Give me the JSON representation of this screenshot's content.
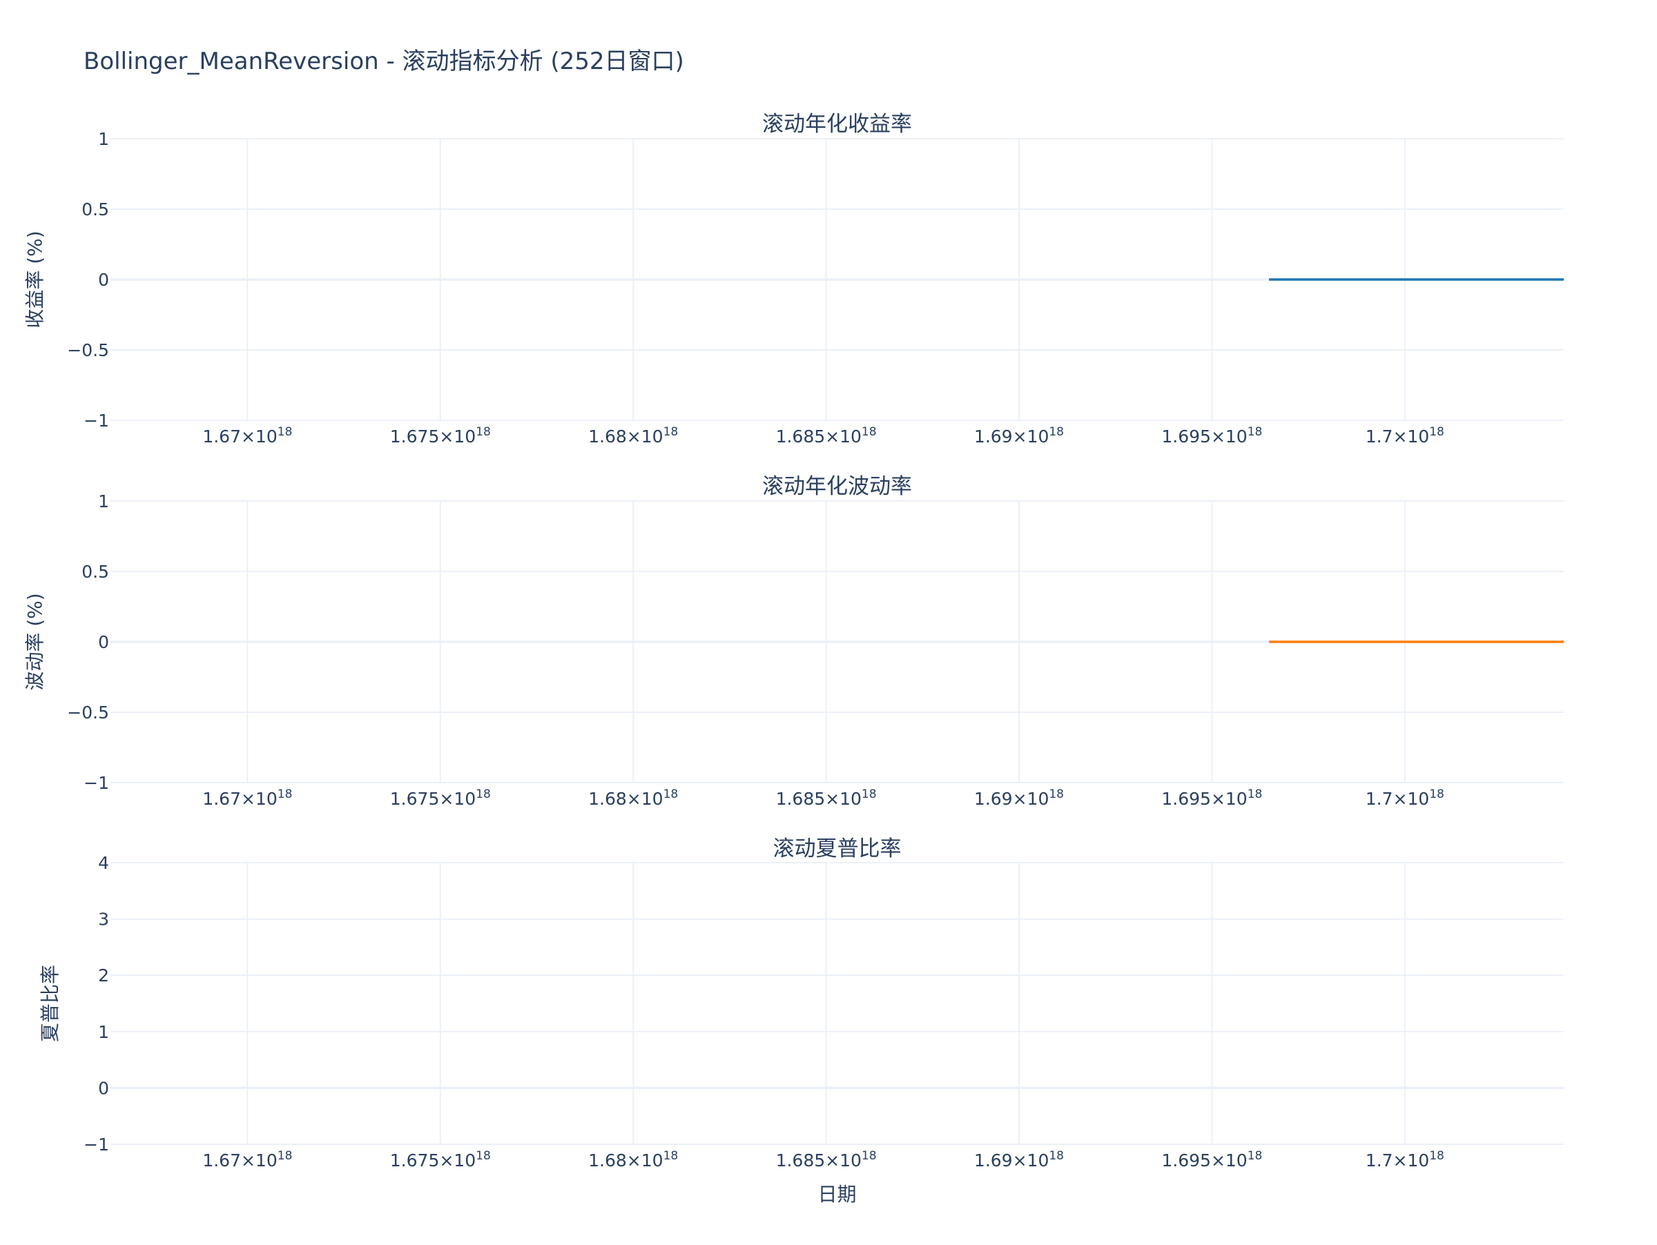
{
  "title": "Bollinger_MeanReversion - 滚动指标分析 (252日窗口)",
  "colors": {
    "text": "#2a3f5f",
    "grid": "#ebf0f8",
    "series_return": "#1f77b4",
    "series_vol": "#ff7f0e",
    "series_sharpe": "#2ca02c"
  },
  "chart_data": [
    {
      "type": "line",
      "title": "滚动年化收益率",
      "ylabel": "收益率 (%)",
      "xlabel": "",
      "ylim": [
        -1,
        1
      ],
      "y_ticks": [
        "1",
        "0.5",
        "0",
        "−0.5",
        "−1"
      ],
      "y_tick_values": [
        1,
        0.5,
        0,
        -0.5,
        -1
      ],
      "x_ticks": [
        {
          "value": 1.67e+18,
          "mantissa": "1.67",
          "exp": "18"
        },
        {
          "value": 1.675e+18,
          "mantissa": "1.675",
          "exp": "18"
        },
        {
          "value": 1.68e+18,
          "mantissa": "1.68",
          "exp": "18"
        },
        {
          "value": 1.685e+18,
          "mantissa": "1.685",
          "exp": "18"
        },
        {
          "value": 1.69e+18,
          "mantissa": "1.69",
          "exp": "18"
        },
        {
          "value": 1.695e+18,
          "mantissa": "1.695",
          "exp": "18"
        },
        {
          "value": 1.7e+18,
          "mantissa": "1.7",
          "exp": "18"
        }
      ],
      "xlim": [
        1.66645e+18,
        1.70412e+18
      ],
      "grid": true,
      "series": [
        {
          "x": [
            1.69648e+18,
            1.70412e+18
          ],
          "y": [
            0,
            0
          ],
          "color": "#1f77b4"
        }
      ]
    },
    {
      "type": "line",
      "title": "滚动年化波动率",
      "ylabel": "波动率 (%)",
      "xlabel": "",
      "ylim": [
        -1,
        1
      ],
      "y_ticks": [
        "1",
        "0.5",
        "0",
        "−0.5",
        "−1"
      ],
      "y_tick_values": [
        1,
        0.5,
        0,
        -0.5,
        -1
      ],
      "x_ticks": [
        {
          "value": 1.67e+18,
          "mantissa": "1.67",
          "exp": "18"
        },
        {
          "value": 1.675e+18,
          "mantissa": "1.675",
          "exp": "18"
        },
        {
          "value": 1.68e+18,
          "mantissa": "1.68",
          "exp": "18"
        },
        {
          "value": 1.685e+18,
          "mantissa": "1.685",
          "exp": "18"
        },
        {
          "value": 1.69e+18,
          "mantissa": "1.69",
          "exp": "18"
        },
        {
          "value": 1.695e+18,
          "mantissa": "1.695",
          "exp": "18"
        },
        {
          "value": 1.7e+18,
          "mantissa": "1.7",
          "exp": "18"
        }
      ],
      "xlim": [
        1.66645e+18,
        1.70412e+18
      ],
      "grid": true,
      "series": [
        {
          "x": [
            1.69648e+18,
            1.70412e+18
          ],
          "y": [
            0,
            0
          ],
          "color": "#ff7f0e"
        }
      ]
    },
    {
      "type": "line",
      "title": "滚动夏普比率",
      "ylabel": "夏普比率",
      "xlabel": "日期",
      "ylim": [
        -1,
        4
      ],
      "y_ticks": [
        "4",
        "3",
        "2",
        "1",
        "0",
        "−1"
      ],
      "y_tick_values": [
        4,
        3,
        2,
        1,
        0,
        -1
      ],
      "x_ticks": [
        {
          "value": 1.67e+18,
          "mantissa": "1.67",
          "exp": "18"
        },
        {
          "value": 1.675e+18,
          "mantissa": "1.675",
          "exp": "18"
        },
        {
          "value": 1.68e+18,
          "mantissa": "1.68",
          "exp": "18"
        },
        {
          "value": 1.685e+18,
          "mantissa": "1.685",
          "exp": "18"
        },
        {
          "value": 1.69e+18,
          "mantissa": "1.69",
          "exp": "18"
        },
        {
          "value": 1.695e+18,
          "mantissa": "1.695",
          "exp": "18"
        },
        {
          "value": 1.7e+18,
          "mantissa": "1.7",
          "exp": "18"
        }
      ],
      "xlim": [
        1.66645e+18,
        1.70412e+18
      ],
      "grid": true,
      "series": []
    }
  ]
}
